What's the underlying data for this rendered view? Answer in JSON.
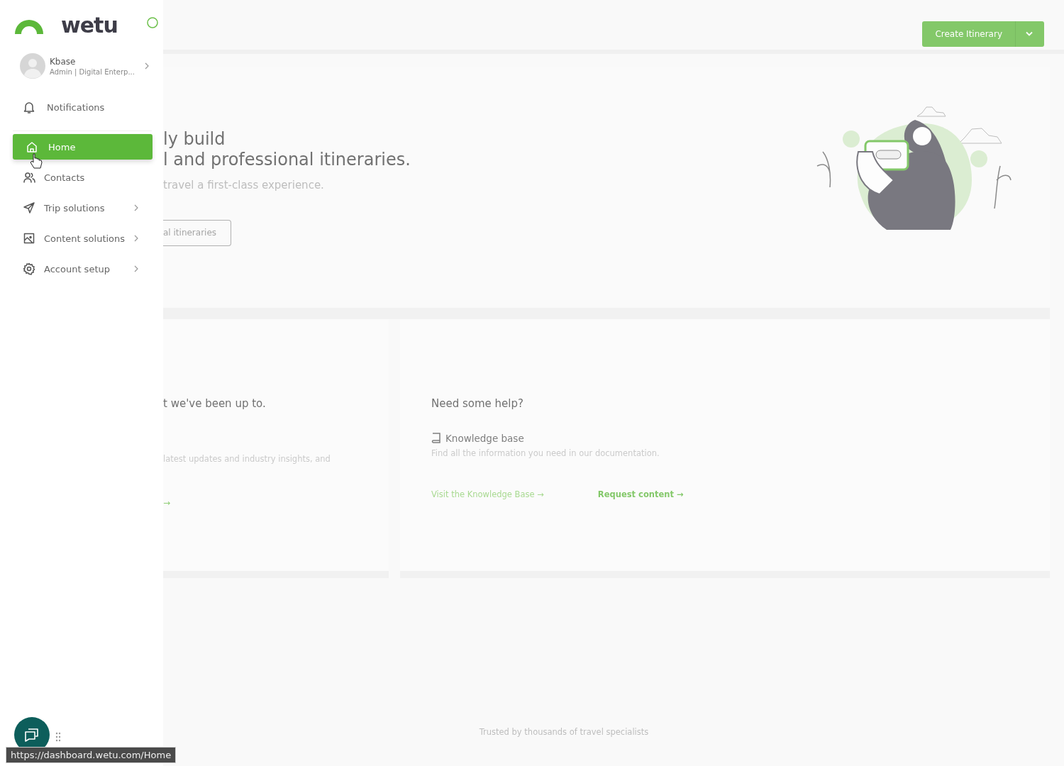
{
  "sidebar": {
    "brand": "wetu",
    "user": {
      "name": "Kbase",
      "role": "Admin | Digital Enterp..."
    },
    "items": [
      {
        "label": "Notifications",
        "selected": false,
        "submenu": false
      },
      {
        "label": "Home",
        "selected": true,
        "submenu": false
      },
      {
        "label": "Contacts",
        "selected": false,
        "submenu": false
      },
      {
        "label": "Trip solutions",
        "selected": false,
        "submenu": true
      },
      {
        "label": "Content solutions",
        "selected": false,
        "submenu": true
      },
      {
        "label": "Account setup",
        "selected": false,
        "submenu": true
      }
    ]
  },
  "topbar": {
    "create_button": "Create Itinerary"
  },
  "hero": {
    "title_lines": [
      "ly build",
      "l and professional itineraries."
    ],
    "subtitle": "travel a first-class experience.",
    "button": "al itineraries"
  },
  "news_card": {
    "title": "t we've been up to.",
    "text": "latest updates and industry insights, and",
    "link": "→"
  },
  "help_card": {
    "title": "Need some help?",
    "item_title": "Knowledge base",
    "item_text": "Find all the information you need in our documentation.",
    "links": [
      "Visit the Knowledge Base →",
      "Request content →"
    ]
  },
  "footer": "Trusted by thousands of travel specialists",
  "status_url": "https://dashboard.wetu.com/Home"
}
